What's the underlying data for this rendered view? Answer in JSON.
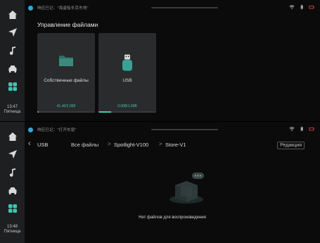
{
  "top": {
    "clock": {
      "time": "13:47",
      "day": "Пятница"
    },
    "status": {
      "text": "响应已记：\"海盗船长京东地\""
    },
    "title": "Управление файлами",
    "cards": [
      {
        "label": "Собственные файлы",
        "usage": "41.40/2,068",
        "fill": 0.02
      },
      {
        "label": "USB",
        "usage": "0.00B/1.00B",
        "fill": 0.22
      }
    ]
  },
  "bottom": {
    "clock": {
      "time": "13:48",
      "day": "Пятница"
    },
    "status": {
      "text": "响应已记：\"打开车窗\""
    },
    "breadcrumb": {
      "back": "‹",
      "usb": "USB",
      "all_files": "Все файлы",
      "sep": ">",
      "folder1": "Spotlight-V100",
      "folder2": "Store-V1"
    },
    "edit_label": "Редакция",
    "empty_text": "Нет файлов для воспроизведения"
  },
  "colors": {
    "accent": "#3fc7b0",
    "status_dot": "#2fa8e0",
    "sidebar": "#1e1f21",
    "card": "#2a2b2d"
  },
  "icons": {
    "sidebar": [
      "home-icon",
      "navigation-icon",
      "music-icon",
      "car-icon",
      "apps-icon"
    ],
    "status": [
      "wifi-icon",
      "bluetooth-icon",
      "battery-icon"
    ]
  }
}
